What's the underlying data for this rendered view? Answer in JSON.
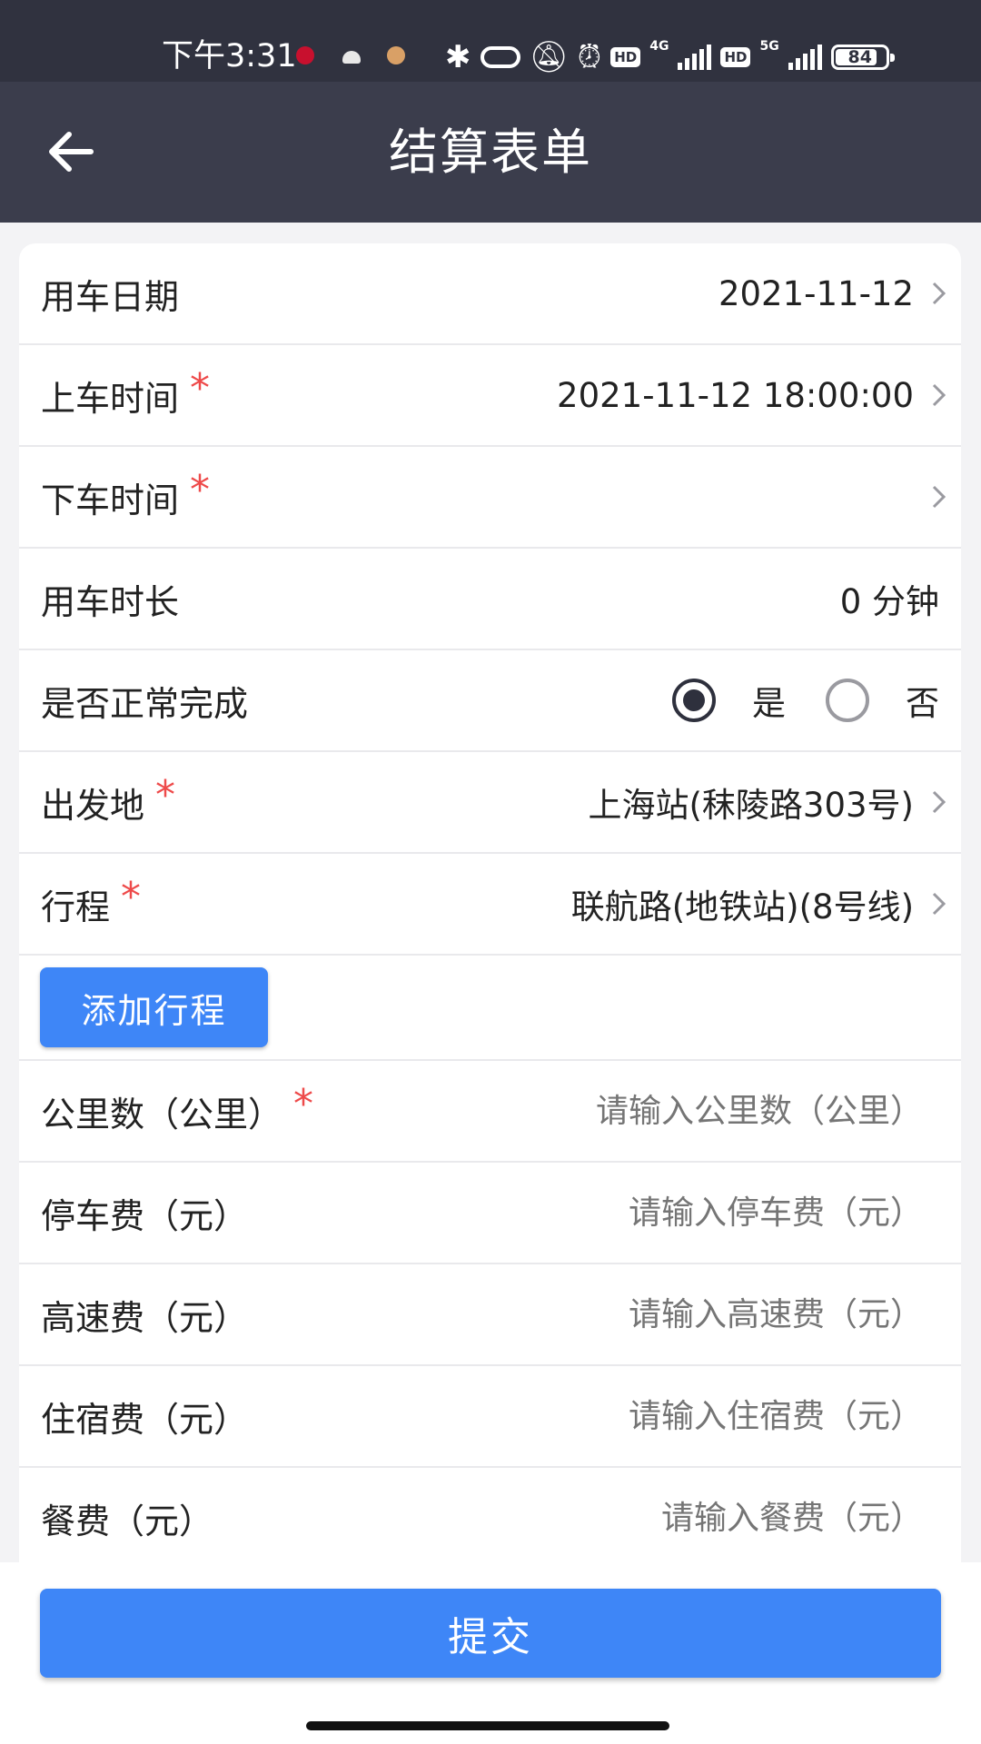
{
  "status_bar": {
    "time": "下午3:31",
    "network_1": "4G",
    "network_2": "5G",
    "hd": "HD",
    "battery": "84",
    "battery_level": 0.84
  },
  "header": {
    "title": "结算表单"
  },
  "form": {
    "date": {
      "label": "用车日期",
      "value": "2021-11-12"
    },
    "pickup_time": {
      "label": "上车时间",
      "value": "2021-11-12 18:00:00"
    },
    "dropoff_time": {
      "label": "下车时间",
      "value": ""
    },
    "duration": {
      "label": "用车时长",
      "value": "0 分钟"
    },
    "completed": {
      "label": "是否正常完成",
      "yes": "是",
      "no": "否",
      "selected": "是"
    },
    "departure": {
      "label": "出发地",
      "value": "上海站(秣陵路303号)"
    },
    "route": {
      "label": "行程",
      "value": "联航路(地铁站)(8号线)"
    },
    "add_route_label": "添加行程",
    "mileage": {
      "label": "公里数（公里）",
      "placeholder": "请输入公里数（公里）"
    },
    "parking": {
      "label": "停车费（元）",
      "placeholder": "请输入停车费（元）"
    },
    "toll": {
      "label": "高速费（元）",
      "placeholder": "请输入高速费（元）"
    },
    "lodging": {
      "label": "住宿费（元）",
      "placeholder": "请输入住宿费（元）"
    },
    "meal": {
      "label": "餐费（元）",
      "placeholder": "请输入餐费（元）"
    },
    "required_mark": "*"
  },
  "submit_label": "提交",
  "colors": {
    "status_bar_bg": "#30323f",
    "header_bg": "#3b3d4c",
    "accent": "#3e86f7",
    "required": "#ee4a4a",
    "placeholder": "#b8b8bd"
  }
}
